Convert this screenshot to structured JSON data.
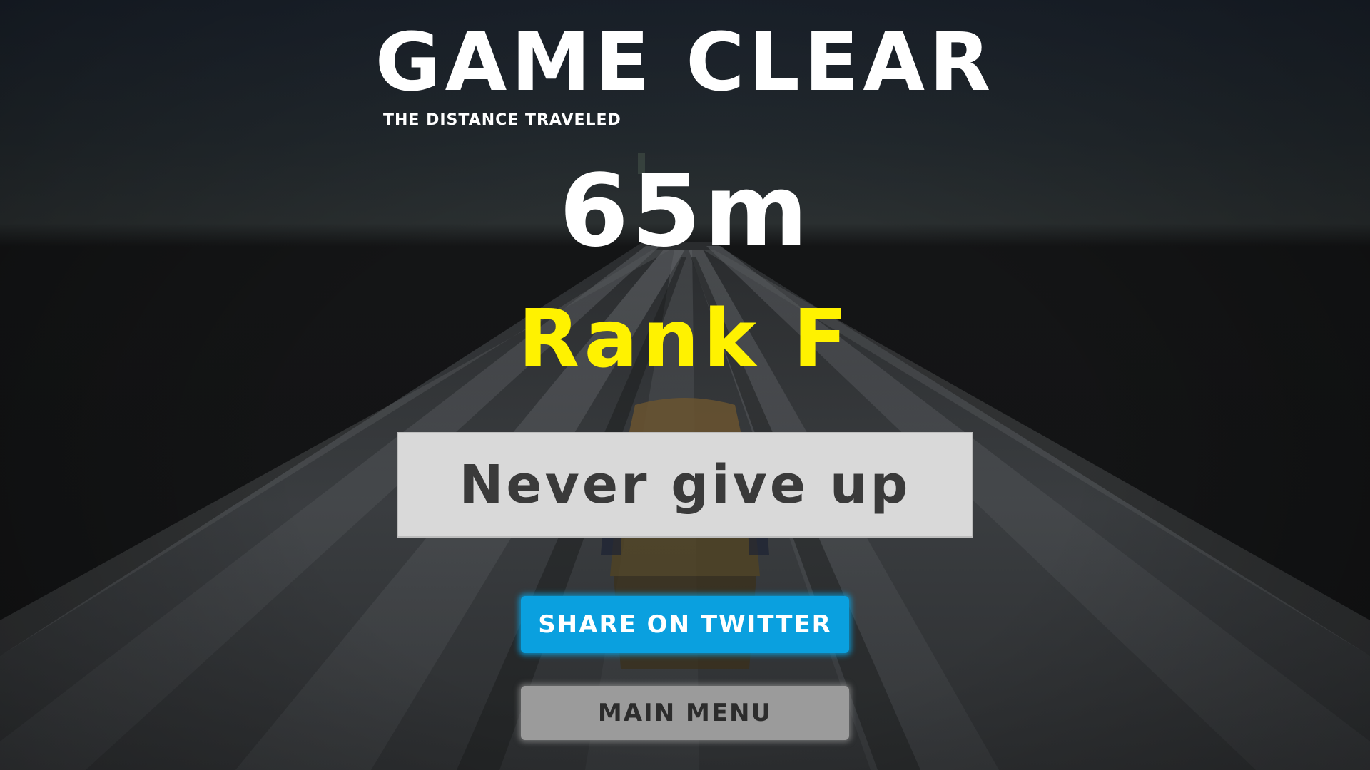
{
  "title": "GAME CLEAR",
  "subtitle": "THE DISTANCE TRAVELED",
  "distance": "65m",
  "rank": "Rank F",
  "message": "Never give up",
  "buttons": {
    "share": "SHARE ON TWITTER",
    "menu": "MAIN MENU"
  },
  "colors": {
    "rank": "#fff200",
    "share_button": "#0aa0df",
    "menu_button": "#9b9b9b",
    "message_box": "#d9d9d9"
  }
}
